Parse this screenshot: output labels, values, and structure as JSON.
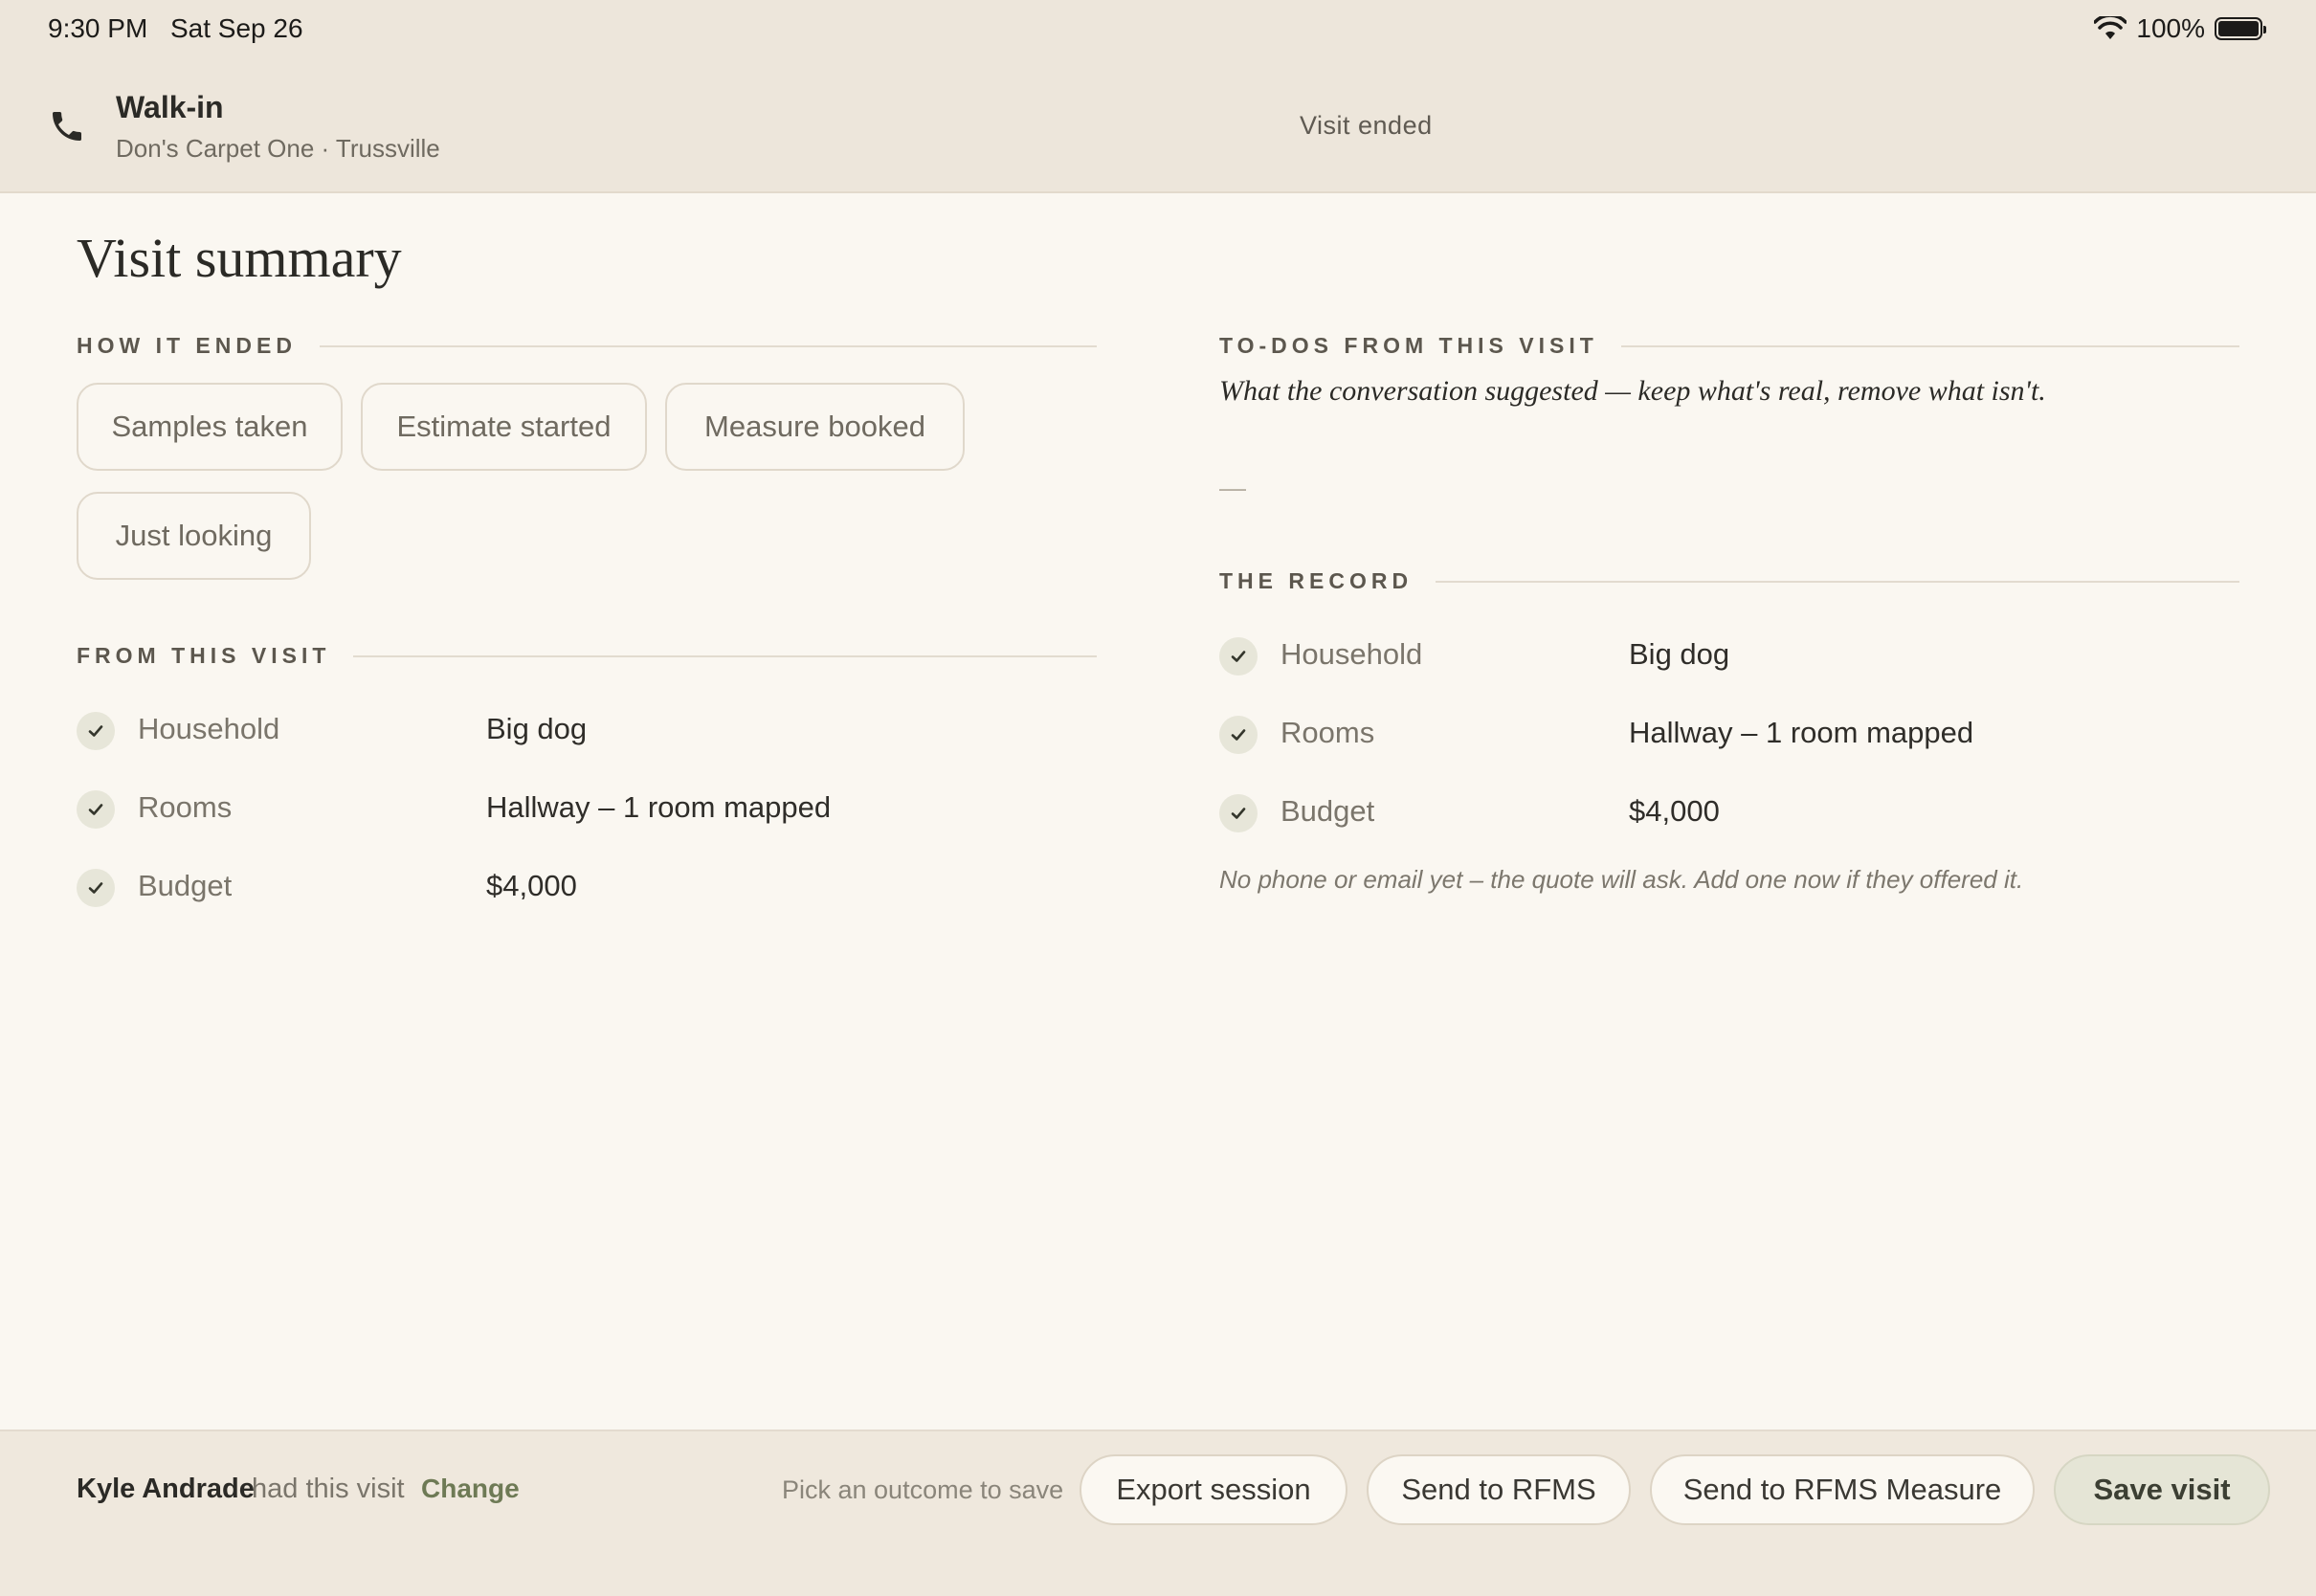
{
  "status_bar": {
    "time": "9:30 PM",
    "date": "Sat Sep 26",
    "battery": "100%",
    "battery_level": 1.0
  },
  "header": {
    "icon": "phone-icon",
    "title": "Walk-in",
    "subtitle": "Don's Carpet One · Trussville",
    "status": "Visit ended"
  },
  "page": {
    "title": "Visit summary"
  },
  "how_it_ended": {
    "heading": "HOW IT ENDED",
    "options": [
      "Samples taken",
      "Estimate started",
      "Measure booked",
      "Just looking"
    ]
  },
  "from_this_visit": {
    "heading": "FROM THIS VISIT",
    "rows": [
      {
        "label": "Household",
        "value": "Big dog"
      },
      {
        "label": "Rooms",
        "value": "Hallway – 1 room mapped"
      },
      {
        "label": "Budget",
        "value": "$4,000"
      }
    ]
  },
  "todos": {
    "heading": "TO-DOS FROM THIS VISIT",
    "subtitle": "What the conversation suggested — keep what's real, remove what isn't.",
    "empty": "—"
  },
  "record": {
    "heading": "THE RECORD",
    "rows": [
      {
        "label": "Household",
        "value": "Big dog"
      },
      {
        "label": "Rooms",
        "value": "Hallway – 1 room mapped"
      },
      {
        "label": "Budget",
        "value": "$4,000"
      }
    ],
    "note": "No phone or email yet – the quote will ask. Add one now if they offered it."
  },
  "footer": {
    "user_name": "Kyle Andrade",
    "had_visit": "had this visit",
    "change_label": "Change",
    "hint": "Pick an outcome to save",
    "buttons": {
      "export": "Export session",
      "send_rfms": "Send to RFMS",
      "send_rfms_measure": "Send to RFMS Measure",
      "save": "Save visit"
    }
  },
  "colors": {
    "background": "#faf7f1",
    "header": "#ede6db",
    "accent_green": "#6e7a55",
    "check_bg": "#e7e6d9"
  }
}
